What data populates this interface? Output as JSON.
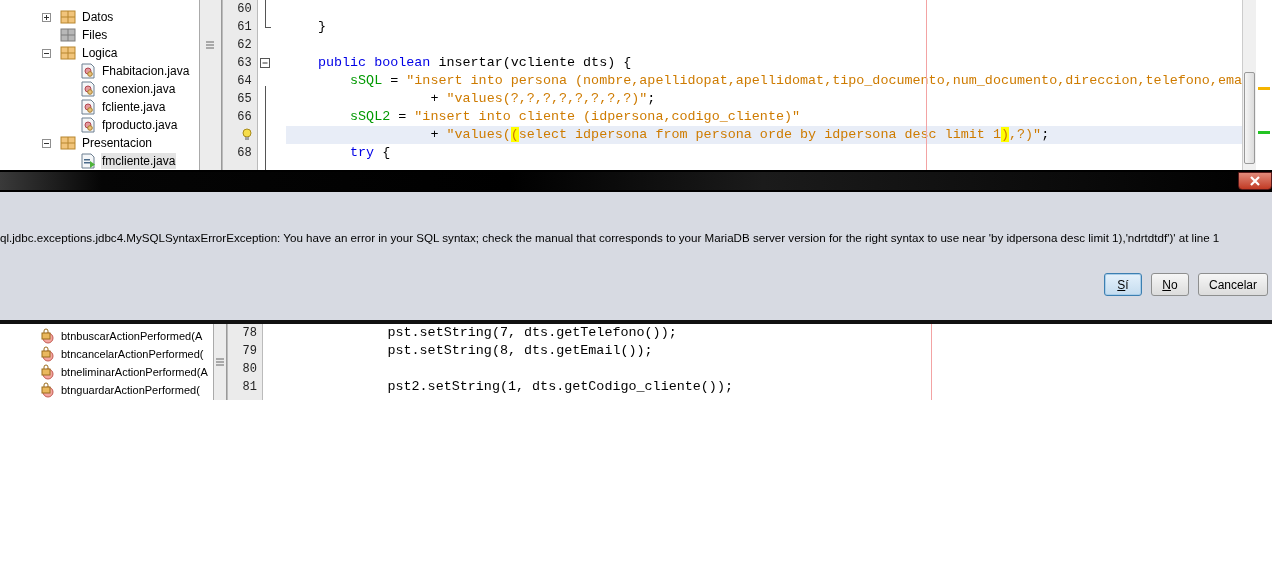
{
  "project_tree": [
    {
      "label": "Datos",
      "kind": "package",
      "expanded": false
    },
    {
      "label": "Files",
      "kind": "empty-package"
    },
    {
      "label": "Logica",
      "kind": "package",
      "expanded": true,
      "children": [
        {
          "label": "Fhabitacion.java",
          "kind": "java",
          "selected": false
        },
        {
          "label": "conexion.java",
          "kind": "java",
          "selected": false
        },
        {
          "label": "fcliente.java",
          "kind": "java",
          "selected": false
        },
        {
          "label": "fproducto.java",
          "kind": "java",
          "selected": false
        }
      ]
    },
    {
      "label": "Presentacion",
      "kind": "package",
      "expanded": true,
      "children": [
        {
          "label": "fmcliente.java",
          "kind": "form",
          "selected": true
        }
      ]
    }
  ],
  "editor_lines": [
    {
      "number": "60",
      "current": false
    },
    {
      "number": "61",
      "current": false,
      "tokens": [
        {
          "kind": "plain",
          "text": "    }"
        }
      ]
    },
    {
      "number": "62",
      "current": false
    },
    {
      "number": "63",
      "expanded": true,
      "current": false,
      "tokens": [
        {
          "kind": "keyword",
          "text": "    public boolean "
        },
        {
          "kind": "plain",
          "text": "insertar(vcliente dts) {"
        }
      ]
    },
    {
      "number": "64",
      "current": false,
      "tokens": [
        {
          "kind": "field",
          "text": "        sSQL"
        },
        {
          "kind": "plain",
          "text": " = "
        },
        {
          "kind": "string",
          "text": "\"insert into persona (nombre,apellidopat,apellidomat,tipo_documento,num_documento,direccion,telefono,ema"
        }
      ]
    },
    {
      "number": "65",
      "current": false,
      "tokens": [
        {
          "kind": "plain",
          "text": "                  + "
        },
        {
          "kind": "string",
          "text": "\"values(?,?,?,?,?,?,?,?)\""
        },
        {
          "kind": "plain",
          "text": ";"
        }
      ]
    },
    {
      "number": "66",
      "current": false,
      "tokens": [
        {
          "kind": "field",
          "text": "        sSQL2"
        },
        {
          "kind": "plain",
          "text": " = "
        },
        {
          "kind": "string",
          "text": "\"insert into cliente (idpersona,codigo_cliente)\""
        }
      ]
    },
    {
      "hint": true,
      "current": true,
      "tokens": [
        {
          "kind": "plain",
          "text": "                  + "
        },
        {
          "kind": "string",
          "text": "\"values("
        },
        {
          "kind": "match",
          "text": "("
        },
        {
          "kind": "string",
          "text": "select idpersona from persona orde by idpersona desc limit 1"
        },
        {
          "kind": "match",
          "text": ")"
        },
        {
          "kind": "string",
          "text": ",?)\""
        },
        {
          "kind": "plain",
          "text": ";"
        }
      ]
    },
    {
      "number": "68",
      "current": false,
      "tokens": [
        {
          "kind": "keyword",
          "text": "        try "
        },
        {
          "kind": "plain",
          "text": "{"
        }
      ]
    }
  ],
  "dialog": {
    "message": "ql.jdbc.exceptions.jdbc4.MySQLSyntaxErrorException: You have an error in your SQL syntax; check the manual that corresponds to your MariaDB server version for the right syntax to use near 'by idpersona desc limit 1),'ndrtdtdf')' at line 1",
    "buttons": [
      {
        "label": "Sí",
        "selected": true,
        "mnemonic": true
      },
      {
        "label": "No",
        "selected": false,
        "mnemonic": true
      },
      {
        "label": "Cancelar",
        "selected": false,
        "mnemonic": false
      }
    ]
  },
  "navigator_items": [
    {
      "label": "btnbuscarActionPerformed(A"
    },
    {
      "label": "btncancelarActionPerformed("
    },
    {
      "label": "btneliminarActionPerformed(A"
    },
    {
      "label": "btnguardarActionPerformed("
    }
  ],
  "lower_editor_lines": [
    {
      "number": "78",
      "text": "            pst.setString(7, dts.getTelefono());"
    },
    {
      "number": "79",
      "text": "            pst.setString(8, dts.getEmail());"
    },
    {
      "number": "80"
    },
    {
      "number": "81",
      "text": "            pst2.setString(1, dts.getCodigo_cliente());"
    }
  ]
}
